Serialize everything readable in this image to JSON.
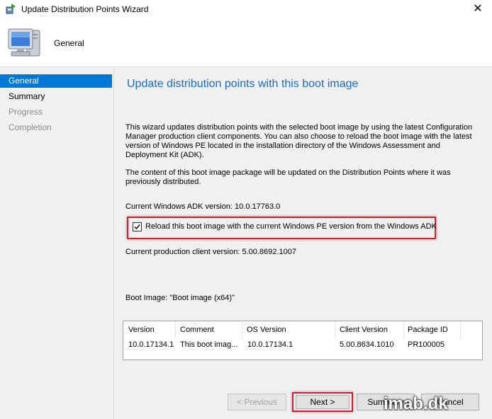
{
  "window": {
    "title": "Update Distribution Points Wizard",
    "close_glyph": "✕"
  },
  "header": {
    "page_name": "General"
  },
  "nav": {
    "items": [
      {
        "label": "General",
        "state": "active"
      },
      {
        "label": "Summary",
        "state": "normal"
      },
      {
        "label": "Progress",
        "state": "disabled"
      },
      {
        "label": "Completion",
        "state": "disabled"
      }
    ]
  },
  "content": {
    "title": "Update distribution points with this boot image",
    "intro": "This wizard updates distribution points with the selected boot image by using the latest Configuration Manager production client components. You can also choose to reload the boot image with the latest version of Windows PE located in the installation directory of the Windows Assessment and Deployment Kit (ADK).",
    "package_note": "The content of this boot image package will be updated on the Distribution Points where it was previously distributed.",
    "adk_version": "Current Windows ADK version: 10.0.17763.0",
    "reload_checkbox": {
      "label": "Reload this boot image with the current Windows PE version from the Windows ADK",
      "checked": true
    },
    "client_version": "Current production client version: 5.00.8692.1007",
    "boot_image": "Boot Image: \"Boot image (x64)\""
  },
  "table": {
    "columns": [
      "Version",
      "Comment",
      "OS Version",
      "Client Version",
      "Package ID"
    ],
    "rows": [
      [
        "10.0.17134.1",
        "This boot imag...",
        "10.0.17134.1",
        "5.00.8634.1010",
        "PR100005"
      ]
    ]
  },
  "buttons": {
    "previous": "< Previous",
    "next": "Next >",
    "summary": "Summary",
    "cancel": "Cancel"
  },
  "watermark": "imab.dk",
  "colors": {
    "accent": "#0078d7",
    "title_blue": "#1e6bbf",
    "highlight_red": "#d0202f"
  }
}
